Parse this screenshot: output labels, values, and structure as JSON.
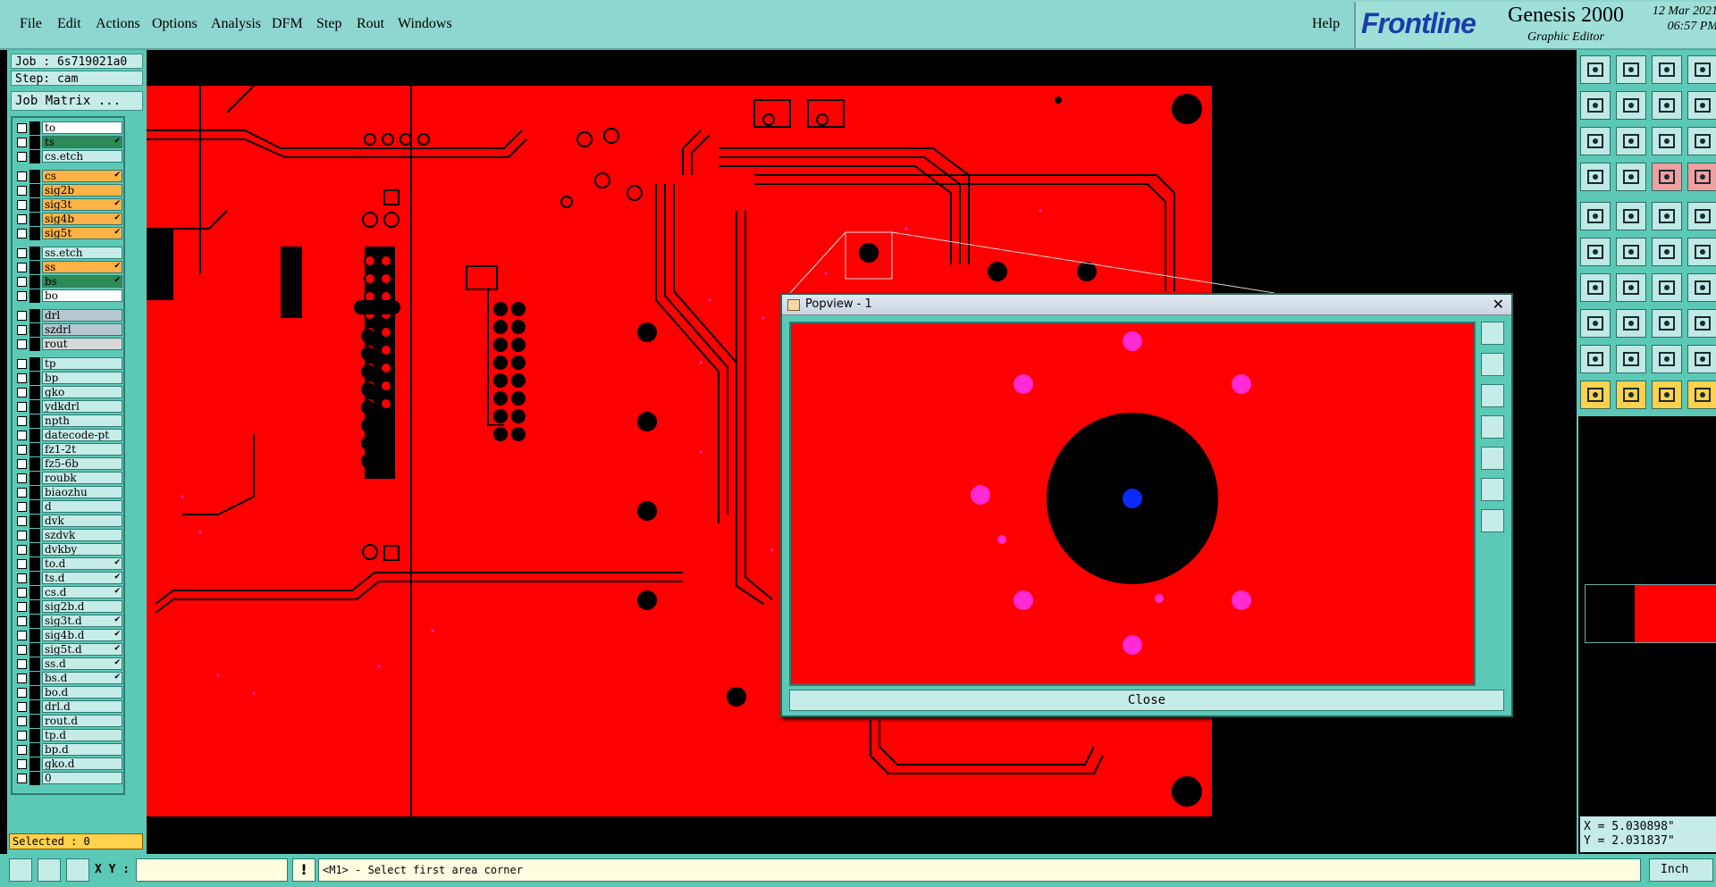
{
  "menu": {
    "items": [
      "File",
      "Edit",
      "Actions",
      "Options",
      "Analysis",
      "DFM",
      "Step",
      "Rout",
      "Windows"
    ],
    "help": "Help"
  },
  "brand": {
    "logo": "Frontline",
    "product": "Genesis 2000",
    "subtitle": "Graphic Editor",
    "date": "12 Mar 2021",
    "time": "06:57 PM"
  },
  "job": {
    "job_label": "Job : 6s719021a0",
    "step_label": "Step: cam",
    "matrix_button": "Job Matrix ..."
  },
  "layers": [
    {
      "name": "to",
      "color": "#ffffff"
    },
    {
      "name": "ts",
      "color": "#2e8b57",
      "flag": "✔"
    },
    {
      "name": "cs.etch",
      "color": "#c6ece8"
    },
    {
      "name": "cs",
      "color": "#ffb347",
      "flag": "✔"
    },
    {
      "name": "sig2b",
      "color": "#ffb347"
    },
    {
      "name": "sig3t",
      "color": "#ffb347",
      "flag": "✔"
    },
    {
      "name": "sig4b",
      "color": "#ffb347",
      "flag": "✔"
    },
    {
      "name": "sig5t",
      "color": "#ffb347",
      "flag": "✔"
    },
    {
      "name": "ss.etch",
      "color": "#c6ece8"
    },
    {
      "name": "ss",
      "color": "#ffb347",
      "flag": "✔"
    },
    {
      "name": "bs",
      "color": "#2e8b57",
      "flag": "✔"
    },
    {
      "name": "bo",
      "color": "#ffffff"
    },
    {
      "name": "drl",
      "color": "#b8c8d0"
    },
    {
      "name": "szdrl",
      "color": "#b8c8d0"
    },
    {
      "name": "rout",
      "color": "#d8d8d8"
    },
    {
      "name": "tp",
      "color": "#c6ece8"
    },
    {
      "name": "bp",
      "color": "#c6ece8"
    },
    {
      "name": "gko",
      "color": "#c6ece8"
    },
    {
      "name": "ydkdrl",
      "color": "#c6ece8"
    },
    {
      "name": "npth",
      "color": "#c6ece8"
    },
    {
      "name": "datecode-pt",
      "color": "#c6ece8"
    },
    {
      "name": "fz1-2t",
      "color": "#c6ece8"
    },
    {
      "name": "fz5-6b",
      "color": "#c6ece8"
    },
    {
      "name": "roubk",
      "color": "#c6ece8"
    },
    {
      "name": "biaozhu",
      "color": "#c6ece8"
    },
    {
      "name": "d",
      "color": "#c6ece8"
    },
    {
      "name": "dvk",
      "color": "#c6ece8"
    },
    {
      "name": "szdvk",
      "color": "#c6ece8"
    },
    {
      "name": "dvkby",
      "color": "#c6ece8"
    },
    {
      "name": "to.d",
      "color": "#c6ece8",
      "flag": "✔"
    },
    {
      "name": "ts.d",
      "color": "#c6ece8",
      "flag": "✔"
    },
    {
      "name": "cs.d",
      "color": "#c6ece8",
      "flag": "✔"
    },
    {
      "name": "sig2b.d",
      "color": "#c6ece8"
    },
    {
      "name": "sig3t.d",
      "color": "#c6ece8",
      "flag": "✔"
    },
    {
      "name": "sig4b.d",
      "color": "#c6ece8",
      "flag": "✔"
    },
    {
      "name": "sig5t.d",
      "color": "#c6ece8",
      "flag": "✔"
    },
    {
      "name": "ss.d",
      "color": "#c6ece8",
      "flag": "✔"
    },
    {
      "name": "bs.d",
      "color": "#c6ece8",
      "flag": "✔"
    },
    {
      "name": "bo.d",
      "color": "#c6ece8"
    },
    {
      "name": "drl.d",
      "color": "#c6ece8"
    },
    {
      "name": "rout.d",
      "color": "#c6ece8"
    },
    {
      "name": "tp.d",
      "color": "#c6ece8"
    },
    {
      "name": "bp.d",
      "color": "#c6ece8"
    },
    {
      "name": "gko.d",
      "color": "#c6ece8"
    },
    {
      "name": "0",
      "color": "#c6ece8"
    }
  ],
  "selected": "Selected : 0",
  "popview": {
    "title": "Popview - 1",
    "close_x": "✕",
    "close_button": "Close"
  },
  "coords": {
    "x": "X = 5.030898\"",
    "y": "Y = 2.031837\""
  },
  "status": {
    "xy_label": "X Y :",
    "xy_value": "",
    "exclaim": "!",
    "prompt": "<M1> - Select first area corner",
    "units": "Inch"
  },
  "colors": {
    "copper": "#fe0000",
    "pad": "#ff2ad4",
    "drill": "#0a2aff",
    "panel": "#5cc9b6"
  }
}
